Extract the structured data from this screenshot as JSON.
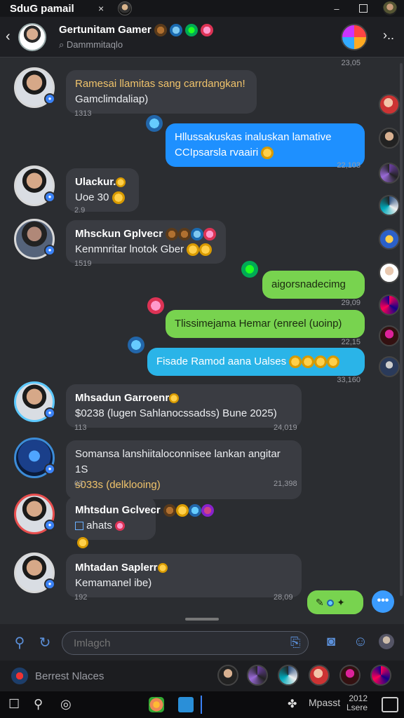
{
  "titlebar": {
    "title": "SduG pamail",
    "close": "×",
    "minimize": "–"
  },
  "header": {
    "back": "‹",
    "name": "Gertunitam Gamer",
    "subtitle": "Dammmitaqlo",
    "more": "›.."
  },
  "header_timestamp": "23,05",
  "messages": [
    {
      "id": "m1",
      "direction": "in",
      "line1": "Ramesai llamitas sang carrdangkan!",
      "line2": "Gamclimdaliap)",
      "time": "1313"
    },
    {
      "id": "m2",
      "direction": "out",
      "color": "#1e90ff",
      "line1": "Hllussakuskas inaluskan lamative",
      "line2": "CCIpsarsla rvaairi",
      "time": "22,103"
    },
    {
      "id": "m3",
      "direction": "in",
      "line1": "Ulackur.",
      "line2": "Uoe 30",
      "time": "2.9"
    },
    {
      "id": "m4",
      "direction": "in",
      "line1": "Mhsckun Gplvecr",
      "line2": "Kenmnritar lnotok Gber",
      "time": "1519"
    },
    {
      "id": "m5",
      "direction": "out",
      "color": "#78d34f",
      "line1": "aigorsnadecimg",
      "time": "29,09"
    },
    {
      "id": "m6",
      "direction": "out",
      "color": "#78d34f",
      "line1": "Tlissimejama Hemar (enreel (uoinp)",
      "time": "22,15"
    },
    {
      "id": "m7",
      "direction": "out",
      "color": "#2ab4e8",
      "line1": "Fisade Ramod aana Ualses",
      "time": "33,160"
    },
    {
      "id": "m8",
      "direction": "in",
      "line1": "Mhsadun Garroenr",
      "line2": "$0238 (lugen Sahlanocssadss) Bune 2025)",
      "time": "113",
      "time2": "24,019"
    },
    {
      "id": "m9",
      "direction": "in",
      "line1": "Somansa lanshiitaloconnisee lankan angitar 1S",
      "line2": "s033s (delklooing)",
      "time": "03",
      "time2": "21,398"
    },
    {
      "id": "m10",
      "direction": "in",
      "line1": "Mhtsdun Gclvecr",
      "line2": "ahats",
      "time": ""
    },
    {
      "id": "m11",
      "direction": "in",
      "line1": "Mhtadan Saplerr",
      "line2": "Kemamanel ibe)",
      "time": "192",
      "time2": "28,09"
    }
  ],
  "input": {
    "placeholder": "Imlagch"
  },
  "strip": {
    "label": "Berrest Nlaces"
  },
  "taskbar": {
    "weather": "Mpasst",
    "clock_line1": "2012",
    "clock_line2": "Lsere"
  },
  "colors": {
    "accent": "#3b9cff",
    "bubble_in": "#3a3c42",
    "bubble_green": "#78d34f"
  }
}
